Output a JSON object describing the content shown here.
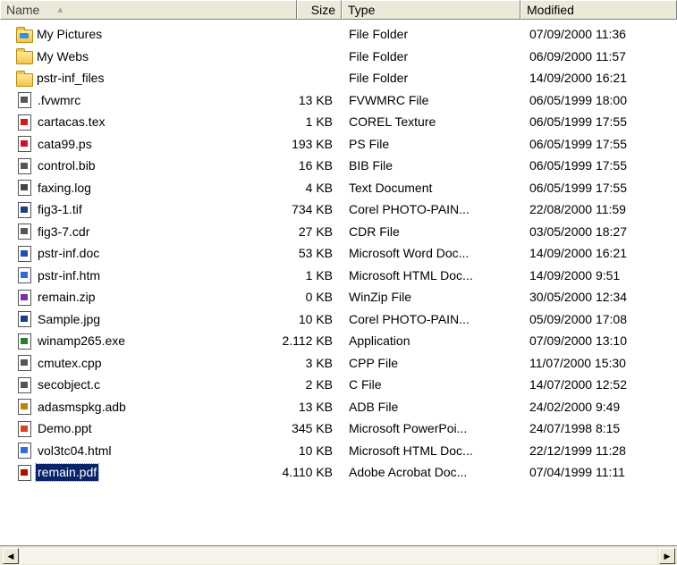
{
  "columns": {
    "name": "Name",
    "size": "Size",
    "type": "Type",
    "modified": "Modified",
    "sort_indicator": "▲"
  },
  "files": [
    {
      "name": "My Pictures",
      "size": "",
      "type": "File Folder",
      "modified": "07/09/2000 11:36",
      "icon": "pictures-folder-icon"
    },
    {
      "name": "My Webs",
      "size": "",
      "type": "File Folder",
      "modified": "06/09/2000 11:57",
      "icon": "folder-icon"
    },
    {
      "name": "pstr-inf_files",
      "size": "",
      "type": "File Folder",
      "modified": "14/09/2000 16:21",
      "icon": "folder-icon"
    },
    {
      "name": ".fvwmrc",
      "size": "13 KB",
      "type": "FVWMRC File",
      "modified": "06/05/1999 18:00",
      "icon": "generic-file-icon"
    },
    {
      "name": "cartacas.tex",
      "size": "1 KB",
      "type": "COREL Texture",
      "modified": "06/05/1999 17:55",
      "icon": "corel-texture-icon"
    },
    {
      "name": "cata99.ps",
      "size": "193 KB",
      "type": "PS File",
      "modified": "06/05/1999 17:55",
      "icon": "ps-file-icon"
    },
    {
      "name": "control.bib",
      "size": "16 KB",
      "type": "BIB File",
      "modified": "06/05/1999 17:55",
      "icon": "generic-file-icon"
    },
    {
      "name": "faxing.log",
      "size": "4 KB",
      "type": "Text Document",
      "modified": "06/05/1999 17:55",
      "icon": "text-document-icon"
    },
    {
      "name": "fig3-1.tif",
      "size": "734 KB",
      "type": "Corel PHOTO-PAIN...",
      "modified": "22/08/2000 11:59",
      "icon": "image-file-icon"
    },
    {
      "name": "fig3-7.cdr",
      "size": "27 KB",
      "type": "CDR File",
      "modified": "03/05/2000 18:27",
      "icon": "generic-file-icon"
    },
    {
      "name": "pstr-inf.doc",
      "size": "53 KB",
      "type": "Microsoft Word Doc...",
      "modified": "14/09/2000 16:21",
      "icon": "word-document-icon"
    },
    {
      "name": "pstr-inf.htm",
      "size": "1 KB",
      "type": "Microsoft HTML Doc...",
      "modified": "14/09/2000 9:51",
      "icon": "html-document-icon"
    },
    {
      "name": "remain.zip",
      "size": "0 KB",
      "type": "WinZip File",
      "modified": "30/05/2000 12:34",
      "icon": "zip-file-icon"
    },
    {
      "name": "Sample.jpg",
      "size": "10 KB",
      "type": "Corel PHOTO-PAIN...",
      "modified": "05/09/2000 17:08",
      "icon": "image-file-icon"
    },
    {
      "name": "winamp265.exe",
      "size": "2.112 KB",
      "type": "Application",
      "modified": "07/09/2000 13:10",
      "icon": "application-icon"
    },
    {
      "name": "cmutex.cpp",
      "size": "3 KB",
      "type": "CPP File",
      "modified": "11/07/2000 15:30",
      "icon": "generic-file-icon"
    },
    {
      "name": "secobject.c",
      "size": "2 KB",
      "type": "C File",
      "modified": "14/07/2000 12:52",
      "icon": "generic-file-icon"
    },
    {
      "name": "adasmspkg.adb",
      "size": "13 KB",
      "type": "ADB File",
      "modified": "24/02/2000 9:49",
      "icon": "adb-file-icon"
    },
    {
      "name": "Demo.ppt",
      "size": "345 KB",
      "type": "Microsoft PowerPoi...",
      "modified": "24/07/1998 8:15",
      "icon": "powerpoint-icon"
    },
    {
      "name": "vol3tc04.html",
      "size": "10 KB",
      "type": "Microsoft HTML Doc...",
      "modified": "22/12/1999 11:28",
      "icon": "html-document-icon"
    },
    {
      "name": "remain.pdf",
      "size": "4.110 KB",
      "type": "Adobe Acrobat Doc...",
      "modified": "07/04/1999 11:11",
      "icon": "pdf-file-icon",
      "selected": true
    }
  ],
  "scrollbar": {
    "left_arrow": "◀",
    "right_arrow": "▶"
  }
}
